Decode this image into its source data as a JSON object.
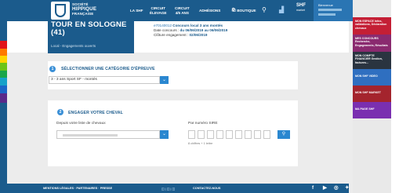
{
  "colors": {
    "brand_blue": "#1b5b8c",
    "accent_blue": "#2a87d0",
    "sidebar_red": "#c41f35",
    "sidebar_orange": "#e46a17"
  },
  "logo": {
    "line1": "SOCIÉTÉ",
    "line2": "HIPPIQUE",
    "line3": "FRANÇAISE"
  },
  "nav": {
    "la_shf": "LA SHF",
    "circuit_elevage": [
      "CIRCUIT",
      "ÉLEVAGE"
    ],
    "circuit_4_5": [
      "CIRCUIT",
      "4/5 ANS"
    ],
    "adhesions": "ADHÉSIONS",
    "boutique": "BOUTIQUE",
    "shf_market_title": "SHF",
    "shf_market_sub": "market",
    "user_label": "Bienvenue"
  },
  "sidebar": [
    {
      "label": "MON ESPACE Infos, validations, Déclaration chevaux",
      "color": "#c41f35"
    },
    {
      "label": "MES CONCOURS Recherche, Engagements, Résultats",
      "color": "#8a2a6f"
    },
    {
      "label": "MON COMPTE FINANCIER Gestion, factures...",
      "color": "#2a3440"
    },
    {
      "label": "MON SHF VIDEO",
      "color": "#2f6fc0"
    },
    {
      "label": "MON SHF MARKET",
      "color": "#a4242d"
    },
    {
      "label": "MA PAGE SHF",
      "color": "#7a2fb0"
    }
  ],
  "header": {
    "title_line1": "TOUR EN SOLOGNE",
    "title_line2": "(41)",
    "subtitle": "Local - Engagements ouverts",
    "contest_link": "e70140012",
    "contest_type": "Concours local 3 ans montés",
    "dates_label": "Date concours :",
    "dates_value": "du 06/06/2019 au 06/06/2019",
    "closing_label": "Clôture engagement :",
    "closing_value": "02/06/2019"
  },
  "step1": {
    "number": "1",
    "title": "SÉLECTIONNER UNE CATÉGORIE D'ÉPREUVE",
    "selected": "3 - 3 ans Sport SF - montés"
  },
  "step2": {
    "number": "2",
    "title": "ENGAGER VOTRE CHEVAL",
    "from_list_label": "Depuis votre liste de chevaux",
    "sire_label": "Par numéro SIRE",
    "hint": "8 chiffres + 1 lettre"
  },
  "footer": {
    "links": "MENTIONS LÉGALES · PARTENAIRES · PRESSE",
    "contact": "CONTACTEZ-NOUS"
  }
}
